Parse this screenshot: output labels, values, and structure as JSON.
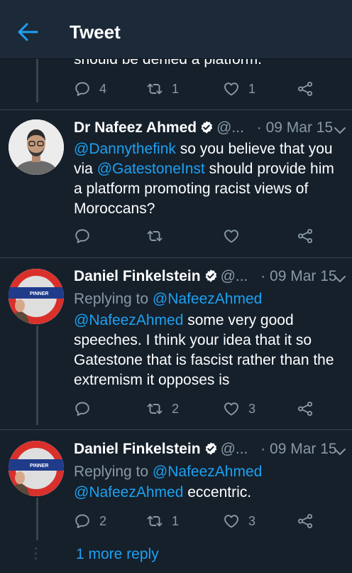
{
  "header": {
    "title": "Tweet"
  },
  "partial_tweet": {
    "text_tail": "should be denied a platform.",
    "replies": "4",
    "retweets": "1",
    "likes": "1"
  },
  "tweets": [
    {
      "name": "Dr Nafeez Ahmed",
      "handle": "@...",
      "date": "· 09 Mar 15",
      "mention1": "@Dannythefink",
      "text1": " so you believe that you via ",
      "mention2": "@GatestoneInst",
      "text2": " should provide him a platform promoting racist views of Moroccans?",
      "replies": "",
      "retweets": "",
      "likes": ""
    },
    {
      "name": "Daniel Finkelstein",
      "handle": "@...",
      "date": "· 09 Mar 15",
      "reply_prefix": "Replying to ",
      "reply_to": "@NafeezAhmed",
      "mention": "@NafeezAhmed",
      "text": " some very good speeches. I think your idea that it so Gatestone that is fascist rather than the extremism it opposes is",
      "replies": "",
      "retweets": "2",
      "likes": "3",
      "avatar_sign": "PINNER"
    },
    {
      "name": "Daniel Finkelstein",
      "handle": "@...",
      "date": "· 09 Mar 15",
      "reply_prefix": "Replying to ",
      "reply_to": "@NafeezAhmed",
      "mention": "@NafeezAhmed",
      "text": " eccentric.",
      "replies": "2",
      "retweets": "1",
      "likes": "3",
      "avatar_sign": "PINNER"
    }
  ],
  "more_reply": "1 more reply",
  "icons": {
    "back": "arrow-left-icon",
    "reply": "reply-icon",
    "retweet": "retweet-icon",
    "like": "heart-icon",
    "share": "share-icon",
    "verified": "verified-icon",
    "chevron": "chevron-down-icon"
  },
  "colors": {
    "background": "#15202b",
    "header": "#1c2938",
    "accent": "#1da1f2",
    "muted": "#8899a6"
  }
}
